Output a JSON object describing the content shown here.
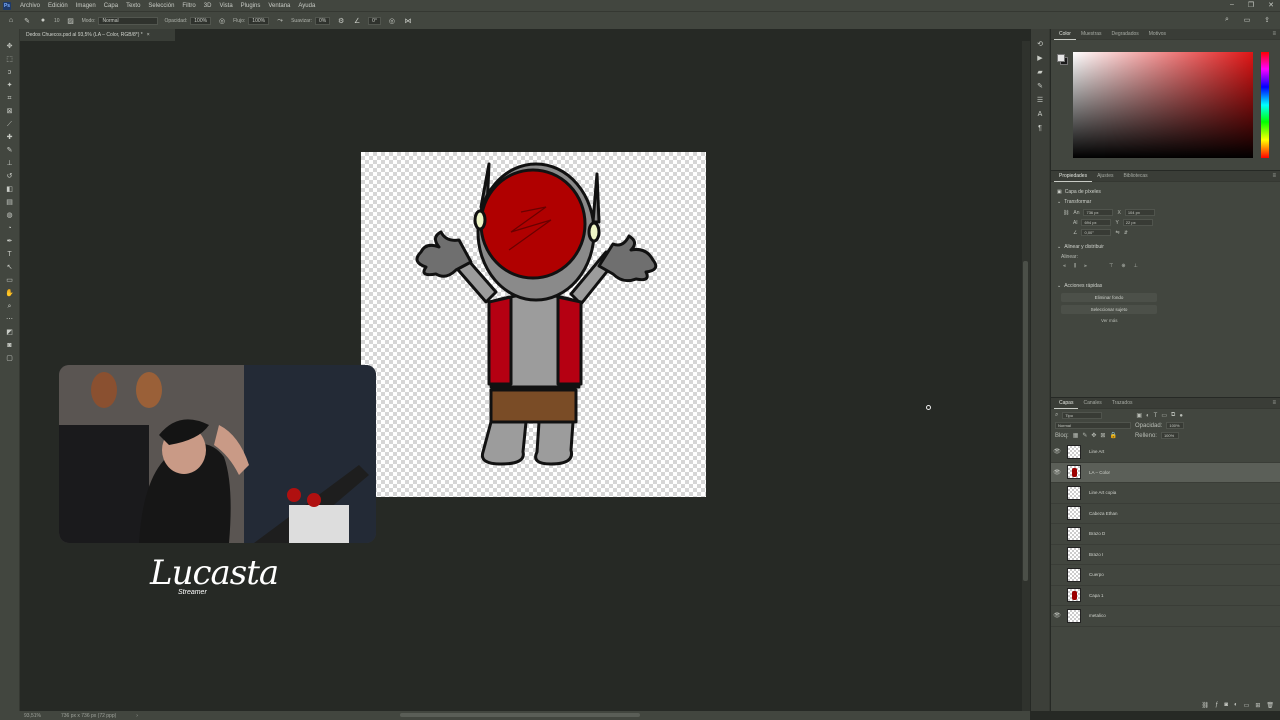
{
  "menubar": {
    "app_icon": "Ps",
    "items": [
      "Archivo",
      "Edición",
      "Imagen",
      "Capa",
      "Texto",
      "Selección",
      "Filtro",
      "3D",
      "Vista",
      "Plugins",
      "Ventana",
      "Ayuda"
    ]
  },
  "options": {
    "mode_label": "Modo:",
    "mode_value": "Normal",
    "opacity_label": "Opacidad:",
    "opacity_value": "100%",
    "flow_label": "Flujo:",
    "flow_value": "100%",
    "smoothing_label": "Suavizar:",
    "smoothing_value": "0%",
    "angle_value": "0°",
    "brush_size": "10"
  },
  "document": {
    "tab_title": "Dedos Chuecos.psd al 93,5% (LA – Color, RGB/8*) *",
    "close": "×"
  },
  "status": {
    "zoom": "93,51%",
    "size": "736 px x 736 px (72 ppp)",
    "arrow": "›"
  },
  "overlay": {
    "streamer_name": "Lucasta",
    "streamer_tag": "Streamer"
  },
  "color_panel": {
    "tabs": [
      "Color",
      "Muestras",
      "Degradados",
      "Motivos"
    ]
  },
  "properties_panel": {
    "tabs": [
      "Propiedades",
      "Ajustes",
      "Bibliotecas"
    ],
    "layer_kind": "Capa de píxeles",
    "transform_title": "Transformar",
    "w_label": "An",
    "w_value": "736 px",
    "x_label": "X",
    "x_value": "104 px",
    "h_label": "Al",
    "h_value": "694 px",
    "y_label": "Y",
    "y_value": "22 px",
    "angle_value": "0,00°",
    "align_title": "Alinear y distribuir",
    "align_sub": "Alinear:",
    "quick_title": "Acciones rápidas",
    "remove_bg": "Eliminar fondo",
    "select_subject": "Seleccionar sujeto",
    "more": "Ver más"
  },
  "layers_panel": {
    "tabs": [
      "Capas",
      "Canales",
      "Trazados"
    ],
    "filter_value": "Tipo",
    "blend_value": "Normal",
    "opacity_label": "Opacidad:",
    "opacity_value": "100%",
    "lock_label": "Bloq:",
    "fill_label": "Relleno:",
    "fill_value": "100%",
    "layers": [
      {
        "name": "Line Art",
        "visible": "👁",
        "selected": false,
        "figure": false
      },
      {
        "name": "LA – Color",
        "visible": "👁",
        "selected": true,
        "figure": true
      },
      {
        "name": "Line Art copia",
        "visible": "",
        "selected": false,
        "figure": false
      },
      {
        "name": "Cabeza Ethan",
        "visible": "",
        "selected": false,
        "figure": false
      },
      {
        "name": "Brazo D",
        "visible": "",
        "selected": false,
        "figure": false
      },
      {
        "name": "Brazo I",
        "visible": "",
        "selected": false,
        "figure": false
      },
      {
        "name": "Cuerpo",
        "visible": "",
        "selected": false,
        "figure": false
      },
      {
        "name": "Capa 1",
        "visible": "",
        "selected": false,
        "figure": true
      },
      {
        "name": "metalico",
        "visible": "👁",
        "selected": false,
        "figure": false
      }
    ]
  },
  "colors": {
    "accent_red": "#b00000",
    "ui_bg": "#42463f",
    "canvas_bg": "#262925"
  }
}
